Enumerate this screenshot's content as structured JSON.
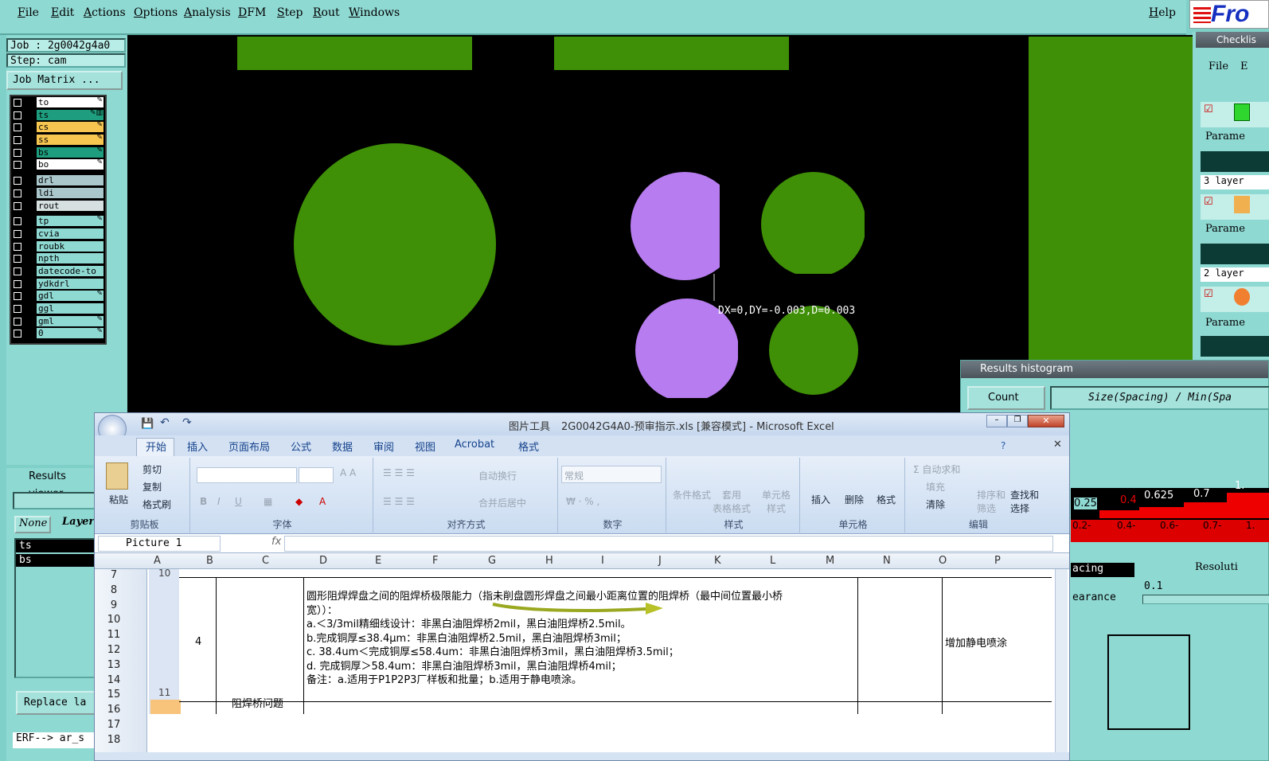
{
  "menu": [
    "File",
    "Edit",
    "Actions",
    "Options",
    "Analysis",
    "DFM",
    "Step",
    "Rout",
    "Windows"
  ],
  "help": "Help",
  "logo": "Fro",
  "job": {
    "job_label": "Job : 2g0042g4a0",
    "step_label": "Step: cam",
    "matrix_button": "Job Matrix ..."
  },
  "layers": [
    {
      "name": "to",
      "color": "#ffffff",
      "pen": "✎"
    },
    {
      "name": "ts",
      "color": "#1e9e7e",
      "pen": "✎▥"
    },
    {
      "name": "cs",
      "color": "#f7c650",
      "pen": "✎"
    },
    {
      "name": "ss",
      "color": "#f7c650",
      "pen": "✎"
    },
    {
      "name": "bs",
      "color": "#1e9e7e",
      "pen": "✎"
    },
    {
      "name": "bo",
      "color": "#ffffff",
      "pen": "✎"
    },
    {
      "name": "drl",
      "color": "#aac7cc",
      "pen": ""
    },
    {
      "name": "ldi",
      "color": "#aac7cc",
      "pen": ""
    },
    {
      "name": "rout",
      "color": "#d6e0e0",
      "pen": ""
    },
    {
      "name": "tp",
      "color": "#8fd9d3",
      "pen": "✎"
    },
    {
      "name": "cvia",
      "color": "#8fd9d3",
      "pen": ""
    },
    {
      "name": "roubk",
      "color": "#8fd9d3",
      "pen": ""
    },
    {
      "name": "npth",
      "color": "#8fd9d3",
      "pen": ""
    },
    {
      "name": "datecode-to",
      "color": "#8fd9d3",
      "pen": ""
    },
    {
      "name": "ydkdrl",
      "color": "#8fd9d3",
      "pen": ""
    },
    {
      "name": "gdl",
      "color": "#8fd9d3",
      "pen": "✎"
    },
    {
      "name": "ggl",
      "color": "#8fd9d3",
      "pen": ""
    },
    {
      "name": "gml",
      "color": "#8fd9d3",
      "pen": "✎"
    },
    {
      "name": "0",
      "color": "#8fd9d3",
      "pen": "✎"
    }
  ],
  "canvas": {
    "measure": "DX=0,DY=-0.003,D=0.003"
  },
  "right": {
    "checklist": "Checklis",
    "file": "File",
    "e": "E",
    "param": "Parame",
    "layers3": "3 layer",
    "layers2": "2 layer"
  },
  "histogram": {
    "title": "Results histogram",
    "count": "Count",
    "size_label": "Size(Spacing) / Min(Spa",
    "bar_vals": [
      "0.25",
      "0.4",
      "0.625",
      "0.7",
      "1."
    ],
    "ranges": [
      "0.2-\n0.3",
      "0.4-\n0.5",
      "0.6-\n0.7",
      "0.7-\n0.8",
      "1."
    ],
    "spacing": "acing",
    "clearance": "earance",
    "resolution": "Resoluti",
    "res_val": "0.1"
  },
  "results_viewer": {
    "title": "Results viewer",
    "none": "None",
    "layer": "Layer",
    "items": [
      "ts",
      "bs"
    ],
    "replace": "Replace la",
    "erf": "ERF--> ar_s"
  },
  "excel": {
    "title_tool": "图片工具",
    "title": "2G0042G4A0-预审指示.xls  [兼容模式] - Microsoft Excel",
    "tabs": [
      "开始",
      "插入",
      "页面布局",
      "公式",
      "数据",
      "审阅",
      "视图",
      "Acrobat",
      "格式"
    ],
    "groups": {
      "clipboard": "剪贴板",
      "font": "字体",
      "align": "对齐方式",
      "number": "数字",
      "style": "样式",
      "cells": "单元格",
      "edit": "编辑"
    },
    "buttons": {
      "paste": "粘贴",
      "cut": "剪切",
      "copy": "复制",
      "painter": "格式刷",
      "wrap": "自动换行",
      "merge": "合并后居中",
      "numfmt": "常规",
      "cond": "条件格式",
      "tablefmt": "套用\n表格格式",
      "cellstyle": "单元格\n样式",
      "insert": "插入",
      "delete": "删除",
      "format": "格式",
      "autosum": "Σ 自动求和",
      "fill": "填充",
      "clear": "清除",
      "sort": "排序和\n筛选",
      "find": "查找和\n选择"
    },
    "namebox": "Picture 1",
    "fx": "fx",
    "cols": [
      "A",
      "B",
      "C",
      "D",
      "E",
      "F",
      "G",
      "H",
      "I",
      "J",
      "K",
      "L",
      "M",
      "N",
      "O",
      "P"
    ],
    "rows": [
      "7",
      "8",
      "9",
      "10",
      "11",
      "12",
      "13",
      "14",
      "15",
      "16",
      "17",
      "18"
    ],
    "cells": {
      "a_top": "10",
      "a_bottom": "11",
      "b_num": "4",
      "c_title": "阻焊桥问题",
      "o_note": "增加静电喷涂",
      "d_lines": [
        "圆形阻焊焊盘之间的阻焊桥极限能力（指未削盘圆形焊盘之间最小距离位置的阻焊桥（最中间位置最小桥",
        "宽））：",
        "a.＜3/3mil精细线设计：非黑白油阻焊桥2mil，黑白油阻焊桥2.5mil。",
        "b.完成铜厚≤38.4μm：非黑白油阻焊桥2.5mil，黑白油阻焊桥3mil；",
        "c. 38.4um＜完成铜厚≤58.4um：非黑白油阻焊桥3mil，黑白油阻焊桥3.5mil；",
        "d. 完成铜厚＞58.4um：非黑白油阻焊桥3mil，黑白油阻焊桥4mil；",
        "备注：a.适用于P1P2P3厂样板和批量；b.适用于静电喷涂。"
      ]
    }
  }
}
